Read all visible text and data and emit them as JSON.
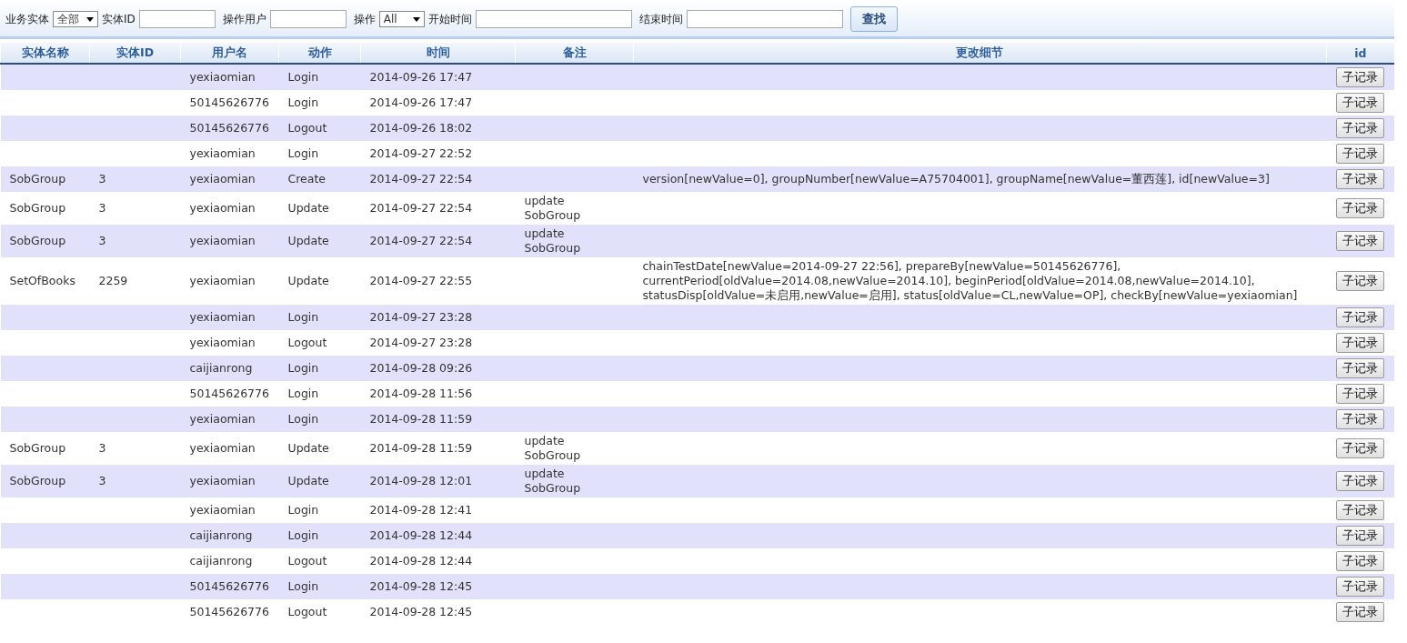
{
  "filters": [
    {
      "kind": "select",
      "label": "业务实体",
      "value": "全部"
    },
    {
      "kind": "input",
      "label": "实体ID"
    },
    {
      "kind": "input",
      "label": "操作用户"
    },
    {
      "kind": "select",
      "label": "操作",
      "value": "All"
    },
    {
      "kind": "date",
      "label": "开始时间"
    },
    {
      "kind": "date",
      "label": "结束时间"
    }
  ],
  "search_button": "查找",
  "table": {
    "columns": [
      "实体名称",
      "实体ID",
      "用户名",
      "动作",
      "时间",
      "备注",
      "更改细节",
      "id"
    ],
    "rows": [
      {
        "entity": "",
        "entity_id": "",
        "user": "yexiaomian",
        "action": "Login",
        "time": "2014-09-26 17:47",
        "note": "",
        "details": "",
        "button": "子记录"
      },
      {
        "entity": "",
        "entity_id": "",
        "user": "50145626776",
        "action": "Login",
        "time": "2014-09-26 17:47",
        "note": "",
        "details": "",
        "button": "子记录"
      },
      {
        "entity": "",
        "entity_id": "",
        "user": "50145626776",
        "action": "Logout",
        "time": "2014-09-26 18:02",
        "note": "",
        "details": "",
        "button": "子记录"
      },
      {
        "entity": "",
        "entity_id": "",
        "user": "yexiaomian",
        "action": "Login",
        "time": "2014-09-27 22:52",
        "note": "",
        "details": "",
        "button": "子记录"
      },
      {
        "entity": "SobGroup",
        "entity_id": "3",
        "user": "yexiaomian",
        "action": "Create",
        "time": "2014-09-27 22:54",
        "note": "",
        "details": "version[newValue=0], groupNumber[newValue=A75704001], groupName[newValue=董西莲], id[newValue=3]",
        "button": "子记录"
      },
      {
        "entity": "SobGroup",
        "entity_id": "3",
        "user": "yexiaomian",
        "action": "Update",
        "time": "2014-09-27 22:54",
        "note": "update SobGroup",
        "details": "",
        "button": "子记录"
      },
      {
        "entity": "SobGroup",
        "entity_id": "3",
        "user": "yexiaomian",
        "action": "Update",
        "time": "2014-09-27 22:54",
        "note": "update SobGroup",
        "details": "",
        "button": "子记录"
      },
      {
        "entity": "SetOfBooks",
        "entity_id": "2259",
        "user": "yexiaomian",
        "action": "Update",
        "time": "2014-09-27 22:55",
        "note": "",
        "details": "chainTestDate[newValue=2014-09-27 22:56], prepareBy[newValue=50145626776], currentPeriod[oldValue=2014.08,newValue=2014.10], beginPeriod[oldValue=2014.08,newValue=2014.10], statusDisp[oldValue=未启用,newValue=启用], status[oldValue=CL,newValue=OP], checkBy[newValue=yexiaomian]",
        "button": "子记录"
      },
      {
        "entity": "",
        "entity_id": "",
        "user": "yexiaomian",
        "action": "Login",
        "time": "2014-09-27 23:28",
        "note": "",
        "details": "",
        "button": "子记录"
      },
      {
        "entity": "",
        "entity_id": "",
        "user": "yexiaomian",
        "action": "Logout",
        "time": "2014-09-27 23:28",
        "note": "",
        "details": "",
        "button": "子记录"
      },
      {
        "entity": "",
        "entity_id": "",
        "user": "caijianrong",
        "action": "Login",
        "time": "2014-09-28 09:26",
        "note": "",
        "details": "",
        "button": "子记录"
      },
      {
        "entity": "",
        "entity_id": "",
        "user": "50145626776",
        "action": "Login",
        "time": "2014-09-28 11:56",
        "note": "",
        "details": "",
        "button": "子记录"
      },
      {
        "entity": "",
        "entity_id": "",
        "user": "yexiaomian",
        "action": "Login",
        "time": "2014-09-28 11:59",
        "note": "",
        "details": "",
        "button": "子记录"
      },
      {
        "entity": "SobGroup",
        "entity_id": "3",
        "user": "yexiaomian",
        "action": "Update",
        "time": "2014-09-28 11:59",
        "note": "update SobGroup",
        "details": "",
        "button": "子记录"
      },
      {
        "entity": "SobGroup",
        "entity_id": "3",
        "user": "yexiaomian",
        "action": "Update",
        "time": "2014-09-28 12:01",
        "note": "update SobGroup",
        "details": "",
        "button": "子记录"
      },
      {
        "entity": "",
        "entity_id": "",
        "user": "yexiaomian",
        "action": "Login",
        "time": "2014-09-28 12:41",
        "note": "",
        "details": "",
        "button": "子记录"
      },
      {
        "entity": "",
        "entity_id": "",
        "user": "caijianrong",
        "action": "Login",
        "time": "2014-09-28 12:44",
        "note": "",
        "details": "",
        "button": "子记录"
      },
      {
        "entity": "",
        "entity_id": "",
        "user": "caijianrong",
        "action": "Logout",
        "time": "2014-09-28 12:44",
        "note": "",
        "details": "",
        "button": "子记录"
      },
      {
        "entity": "",
        "entity_id": "",
        "user": "50145626776",
        "action": "Login",
        "time": "2014-09-28 12:45",
        "note": "",
        "details": "",
        "button": "子记录"
      },
      {
        "entity": "",
        "entity_id": "",
        "user": "50145626776",
        "action": "Logout",
        "time": "2014-09-28 12:45",
        "note": "",
        "details": "",
        "button": "子记录"
      }
    ]
  }
}
